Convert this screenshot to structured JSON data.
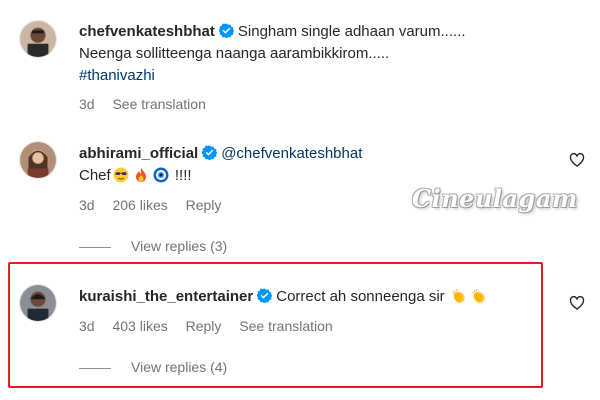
{
  "colors": {
    "verified": "#0095f6",
    "highlight_border": "#e02020",
    "link": "#00376b",
    "muted": "#737373"
  },
  "comments": [
    {
      "username": "chefvenkateshbhat",
      "verified": true,
      "line1": "Singham single adhaan varum......",
      "line2": "Neenga sollitteenga naanga aarambikkirom.....",
      "hashtag": "#thanivazhi",
      "time": "3d",
      "see_translation": "See translation"
    },
    {
      "username": "abhirami_official",
      "verified": true,
      "mention": "@chefvenkateshbhat",
      "text_prefix": "Chef",
      "text_suffix": "!!!!",
      "time": "3d",
      "likes": "206 likes",
      "reply": "Reply",
      "view_replies": "View replies (3)",
      "emojis": [
        "sunglasses-emoji",
        "fire-emoji",
        "nazar-amulet-emoji"
      ]
    },
    {
      "username": "kuraishi_the_entertainer",
      "verified": true,
      "text": "Correct ah sonneenga sir",
      "time": "3d",
      "likes": "403 likes",
      "reply": "Reply",
      "see_translation": "See translation",
      "view_replies": "View replies (4)",
      "emojis": [
        "clapping-hands-emoji",
        "clapping-hands-emoji"
      ]
    }
  ],
  "watermark": "Cineulagam"
}
